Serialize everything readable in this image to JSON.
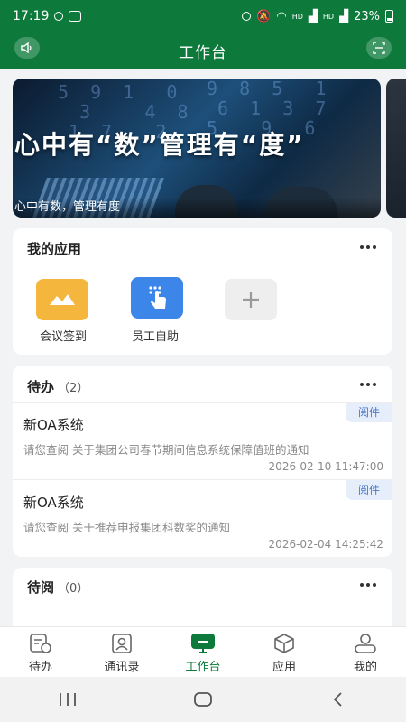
{
  "statusbar": {
    "time": "17:19",
    "battery": "23%",
    "net1": "HD",
    "net2": "HD"
  },
  "header": {
    "title": "工作台",
    "left_icon": "speaker-icon",
    "right_icon": "scan-icon"
  },
  "banner": {
    "slogan": "心中有“数”管理有“度”",
    "caption": "心中有数，管理有度"
  },
  "apps": {
    "title": "我的应用",
    "items": [
      {
        "label": "会议签到",
        "icon": "meeting-checkin-icon",
        "color": "#f4b63c"
      },
      {
        "label": "员工自助",
        "icon": "tap-hand-icon",
        "color": "#3b86e8"
      }
    ],
    "add_icon": "plus-icon"
  },
  "todo": {
    "title": "待办",
    "count": "（2）",
    "items": [
      {
        "system": "新OA系统",
        "desc": "请您查阅 关于集团公司春节期间信息系统保障值班的通知",
        "time": "2026-02-10 11:47:00",
        "tag": "阅件"
      },
      {
        "system": "新OA系统",
        "desc": "请您查阅 关于推荐申报集团科数奖的通知",
        "time": "2026-02-04 14:25:42",
        "tag": "阅件"
      }
    ]
  },
  "toread": {
    "title": "待阅",
    "count": "（0）"
  },
  "tabs": [
    {
      "label": "待办",
      "icon": "todo-icon",
      "active": false
    },
    {
      "label": "通讯录",
      "icon": "contacts-icon",
      "active": false
    },
    {
      "label": "工作台",
      "icon": "workbench-icon",
      "active": true
    },
    {
      "label": "应用",
      "icon": "cube-icon",
      "active": false
    },
    {
      "label": "我的",
      "icon": "profile-icon",
      "active": false
    }
  ],
  "colors": {
    "brand": "#0d7a3c",
    "tag_bg": "#e6eefb",
    "tag_text": "#4a78c8"
  }
}
